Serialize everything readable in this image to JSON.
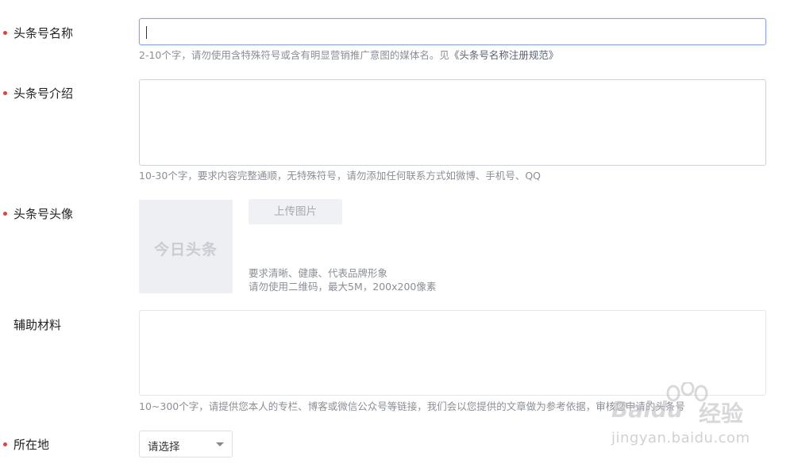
{
  "fields": {
    "name": {
      "label": "头条号名称",
      "hint_prefix": "2-10个字，请勿使用含特殊符号或含有明显营销推广意图的媒体名。见",
      "hint_link": "《头条号名称注册规范》",
      "value": ""
    },
    "intro": {
      "label": "头条号介绍",
      "hint": "10-30个字，要求内容完整通顺，无特殊符号，请勿添加任何联系方式如微博、手机号、QQ",
      "value": ""
    },
    "avatar": {
      "label": "头条号头像",
      "placeholder_logo": "今日头条",
      "upload_label": "上传图片",
      "hint_line1": "要求清晰、健康、代表品牌形象",
      "hint_line2": "请勿使用二维码，最大5M，200x200像素"
    },
    "materials": {
      "label": "辅助材料",
      "hint": "10~300个字，请提供您本人的专栏、博客或微信公众号等链接，我们会以您提供的文章做为参考依据，审核您申请的头条号",
      "value": ""
    },
    "location": {
      "label": "所在地",
      "selected": "请选择"
    }
  },
  "watermark": {
    "brand": "Baidu",
    "suffix": "经验",
    "url": "jingyan.baidu.com"
  },
  "colors": {
    "required_dot": "#d94545",
    "hint_text": "#8a8f96",
    "focus_border": "#8fa4d6"
  }
}
